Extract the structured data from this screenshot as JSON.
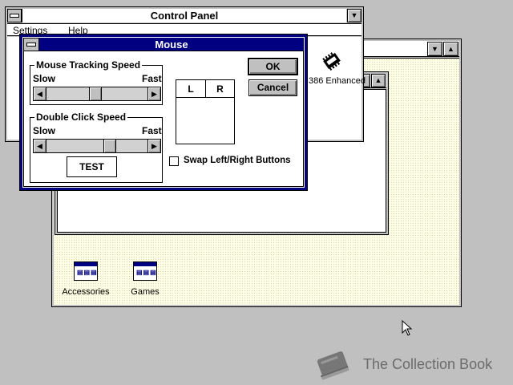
{
  "control_panel": {
    "title": "Control Panel",
    "menu": [
      "Settings",
      "Help"
    ],
    "icon_386_label": "386 Enhanced"
  },
  "program_manager": {
    "groups": [
      {
        "label": "Accessories",
        "icon": "program-group-icon"
      },
      {
        "label": "Games",
        "icon": "program-group-icon"
      }
    ]
  },
  "mouse_dialog": {
    "title": "Mouse",
    "tracking": {
      "label": "Mouse Tracking Speed",
      "slow": "Slow",
      "fast": "Fast",
      "value": 0.48
    },
    "double_click": {
      "label": "Double Click Speed",
      "slow": "Slow",
      "fast": "Fast",
      "value": 0.64
    },
    "test_label": "TEST",
    "left_button": "L",
    "right_button": "R",
    "ok_label": "OK",
    "cancel_label": "Cancel",
    "swap_label": "Swap Left/Right Buttons",
    "swap_checked": false
  },
  "watermark": {
    "text": "The Collection Book"
  }
}
